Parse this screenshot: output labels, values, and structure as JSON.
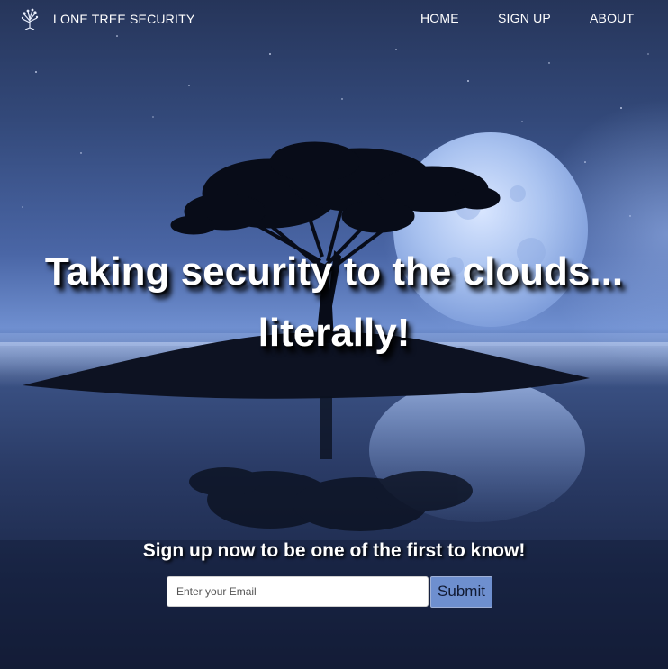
{
  "brand": {
    "logo_icon": "lone-tree-icon",
    "name": "LONE TREE SECURITY"
  },
  "nav": {
    "items": [
      {
        "label": "HOME"
      },
      {
        "label": "SIGN UP"
      },
      {
        "label": "ABOUT"
      }
    ]
  },
  "hero": {
    "line1": "Taking security to the clouds...",
    "line2": "literally!",
    "background": "night-moon-lone-tree-island-image"
  },
  "signup": {
    "prompt": "Sign up now to be one of the first to know!",
    "email_placeholder": "Enter your Email",
    "email_value": "",
    "submit_label": "Submit"
  },
  "colors": {
    "text": "#ffffff",
    "submit_bg": "#6e8fcf",
    "sky_top": "#26355a",
    "horizon": "#6f8fd0"
  }
}
